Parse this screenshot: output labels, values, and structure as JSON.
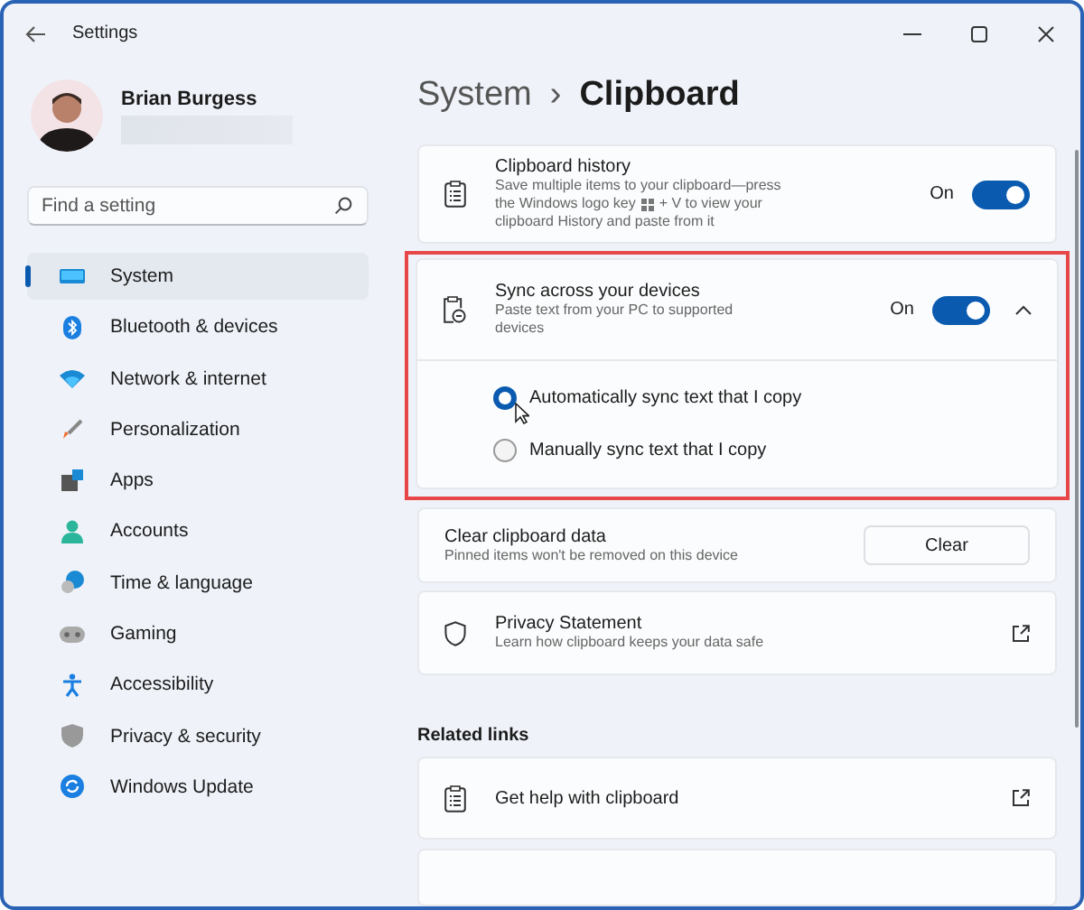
{
  "window": {
    "title": "Settings"
  },
  "profile": {
    "name": "Brian Burgess"
  },
  "search": {
    "placeholder": "Find a setting"
  },
  "nav": [
    {
      "label": "System",
      "selected": true
    },
    {
      "label": "Bluetooth & devices",
      "selected": false
    },
    {
      "label": "Network & internet",
      "selected": false
    },
    {
      "label": "Personalization",
      "selected": false
    },
    {
      "label": "Apps",
      "selected": false
    },
    {
      "label": "Accounts",
      "selected": false
    },
    {
      "label": "Time & language",
      "selected": false
    },
    {
      "label": "Gaming",
      "selected": false
    },
    {
      "label": "Accessibility",
      "selected": false
    },
    {
      "label": "Privacy & security",
      "selected": false
    },
    {
      "label": "Windows Update",
      "selected": false
    }
  ],
  "breadcrumb": {
    "parent": "System",
    "separator": "›",
    "current": "Clipboard"
  },
  "settings": [
    {
      "kind": "toggle",
      "title": "Clipboard history",
      "description": "Save multiple items to your clipboard—press",
      "description_key_before": "the Windows logo key",
      "description_key_after": "+ V to view your",
      "description_end": "clipboard History and paste from it",
      "state_label": "On",
      "on": true
    },
    {
      "kind": "expander",
      "title": "Sync across your devices",
      "description": "Paste text from your PC to supported devices",
      "state_label": "On",
      "on": true,
      "expanded": true,
      "highlighted": true,
      "options": [
        {
          "label": "Automatically sync text that I copy",
          "selected": true
        },
        {
          "label": "Manually sync text that I copy",
          "selected": false
        }
      ]
    },
    {
      "kind": "button",
      "title": "Clear clipboard data",
      "description": "Pinned items won't be removed on this device",
      "button": "Clear"
    },
    {
      "kind": "link",
      "title": "Privacy Statement",
      "description": "Learn how clipboard keeps your data safe"
    }
  ],
  "related": {
    "heading": "Related links",
    "links": [
      {
        "label": "Get help with clipboard"
      }
    ]
  }
}
